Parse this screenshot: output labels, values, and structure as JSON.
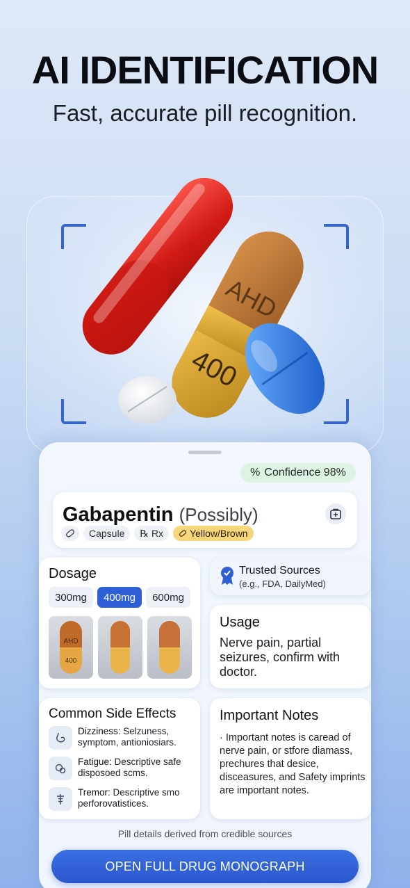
{
  "hero": {
    "title": "AI IDENTIFICATION",
    "subtitle": "Fast, accurate pill recognition."
  },
  "scan": {
    "capsule_imprint_top": "AHD",
    "capsule_imprint_bottom": "400"
  },
  "result": {
    "confidence_icon": "%",
    "confidence_label": "Confidence 98%",
    "drug_name": "Gabapentin",
    "drug_qualifier": "(Possibly)",
    "tags": [
      {
        "icon": "pill-icon",
        "label": "Capsule"
      },
      {
        "icon": "rx-icon",
        "glyph": "℞",
        "label": "Rx"
      },
      {
        "icon": "color-pill-icon",
        "label": "Yellow/Brown",
        "color": "#f7d57a"
      }
    ]
  },
  "dosage": {
    "title": "Dosage",
    "options": [
      "300mg",
      "400mg",
      "600mg"
    ],
    "selected": "400mg",
    "thumb_imprints": [
      "AHD",
      "400"
    ]
  },
  "trusted": {
    "title": "Trusted Sources",
    "subtitle": "(e.g., FDA, DailyMed)"
  },
  "usage": {
    "title": "Usage",
    "text": "Nerve pain, partial seizures, confirm with doctor."
  },
  "side_effects": {
    "title": "Common Side Effects",
    "items": [
      {
        "name": "Dizziness:",
        "desc": " Selzuness, symptom, antioniosiars.",
        "icon": "stomach-icon"
      },
      {
        "name": "Fatigue:",
        "desc": " Descriptive safe disposoed scms.",
        "icon": "pills-icon"
      },
      {
        "name": "Tremor:",
        "desc": " Descriptive smo perforovatistices.",
        "icon": "caduceus-icon"
      }
    ]
  },
  "notes": {
    "title": "Important Notes",
    "text": "· Important notes is caread of nerve pain, or stfore diamass, prechures that desice, disceasures, and Safety imprints are important notes."
  },
  "footer": {
    "note": "Pill details derived from credible sources",
    "cta_label": "OPEN FULL DRUG MONOGRAPH"
  },
  "colors": {
    "accent": "#2f5fd6",
    "confidence_bg": "#dff3e4",
    "tag_yellow": "#f7d57a"
  }
}
